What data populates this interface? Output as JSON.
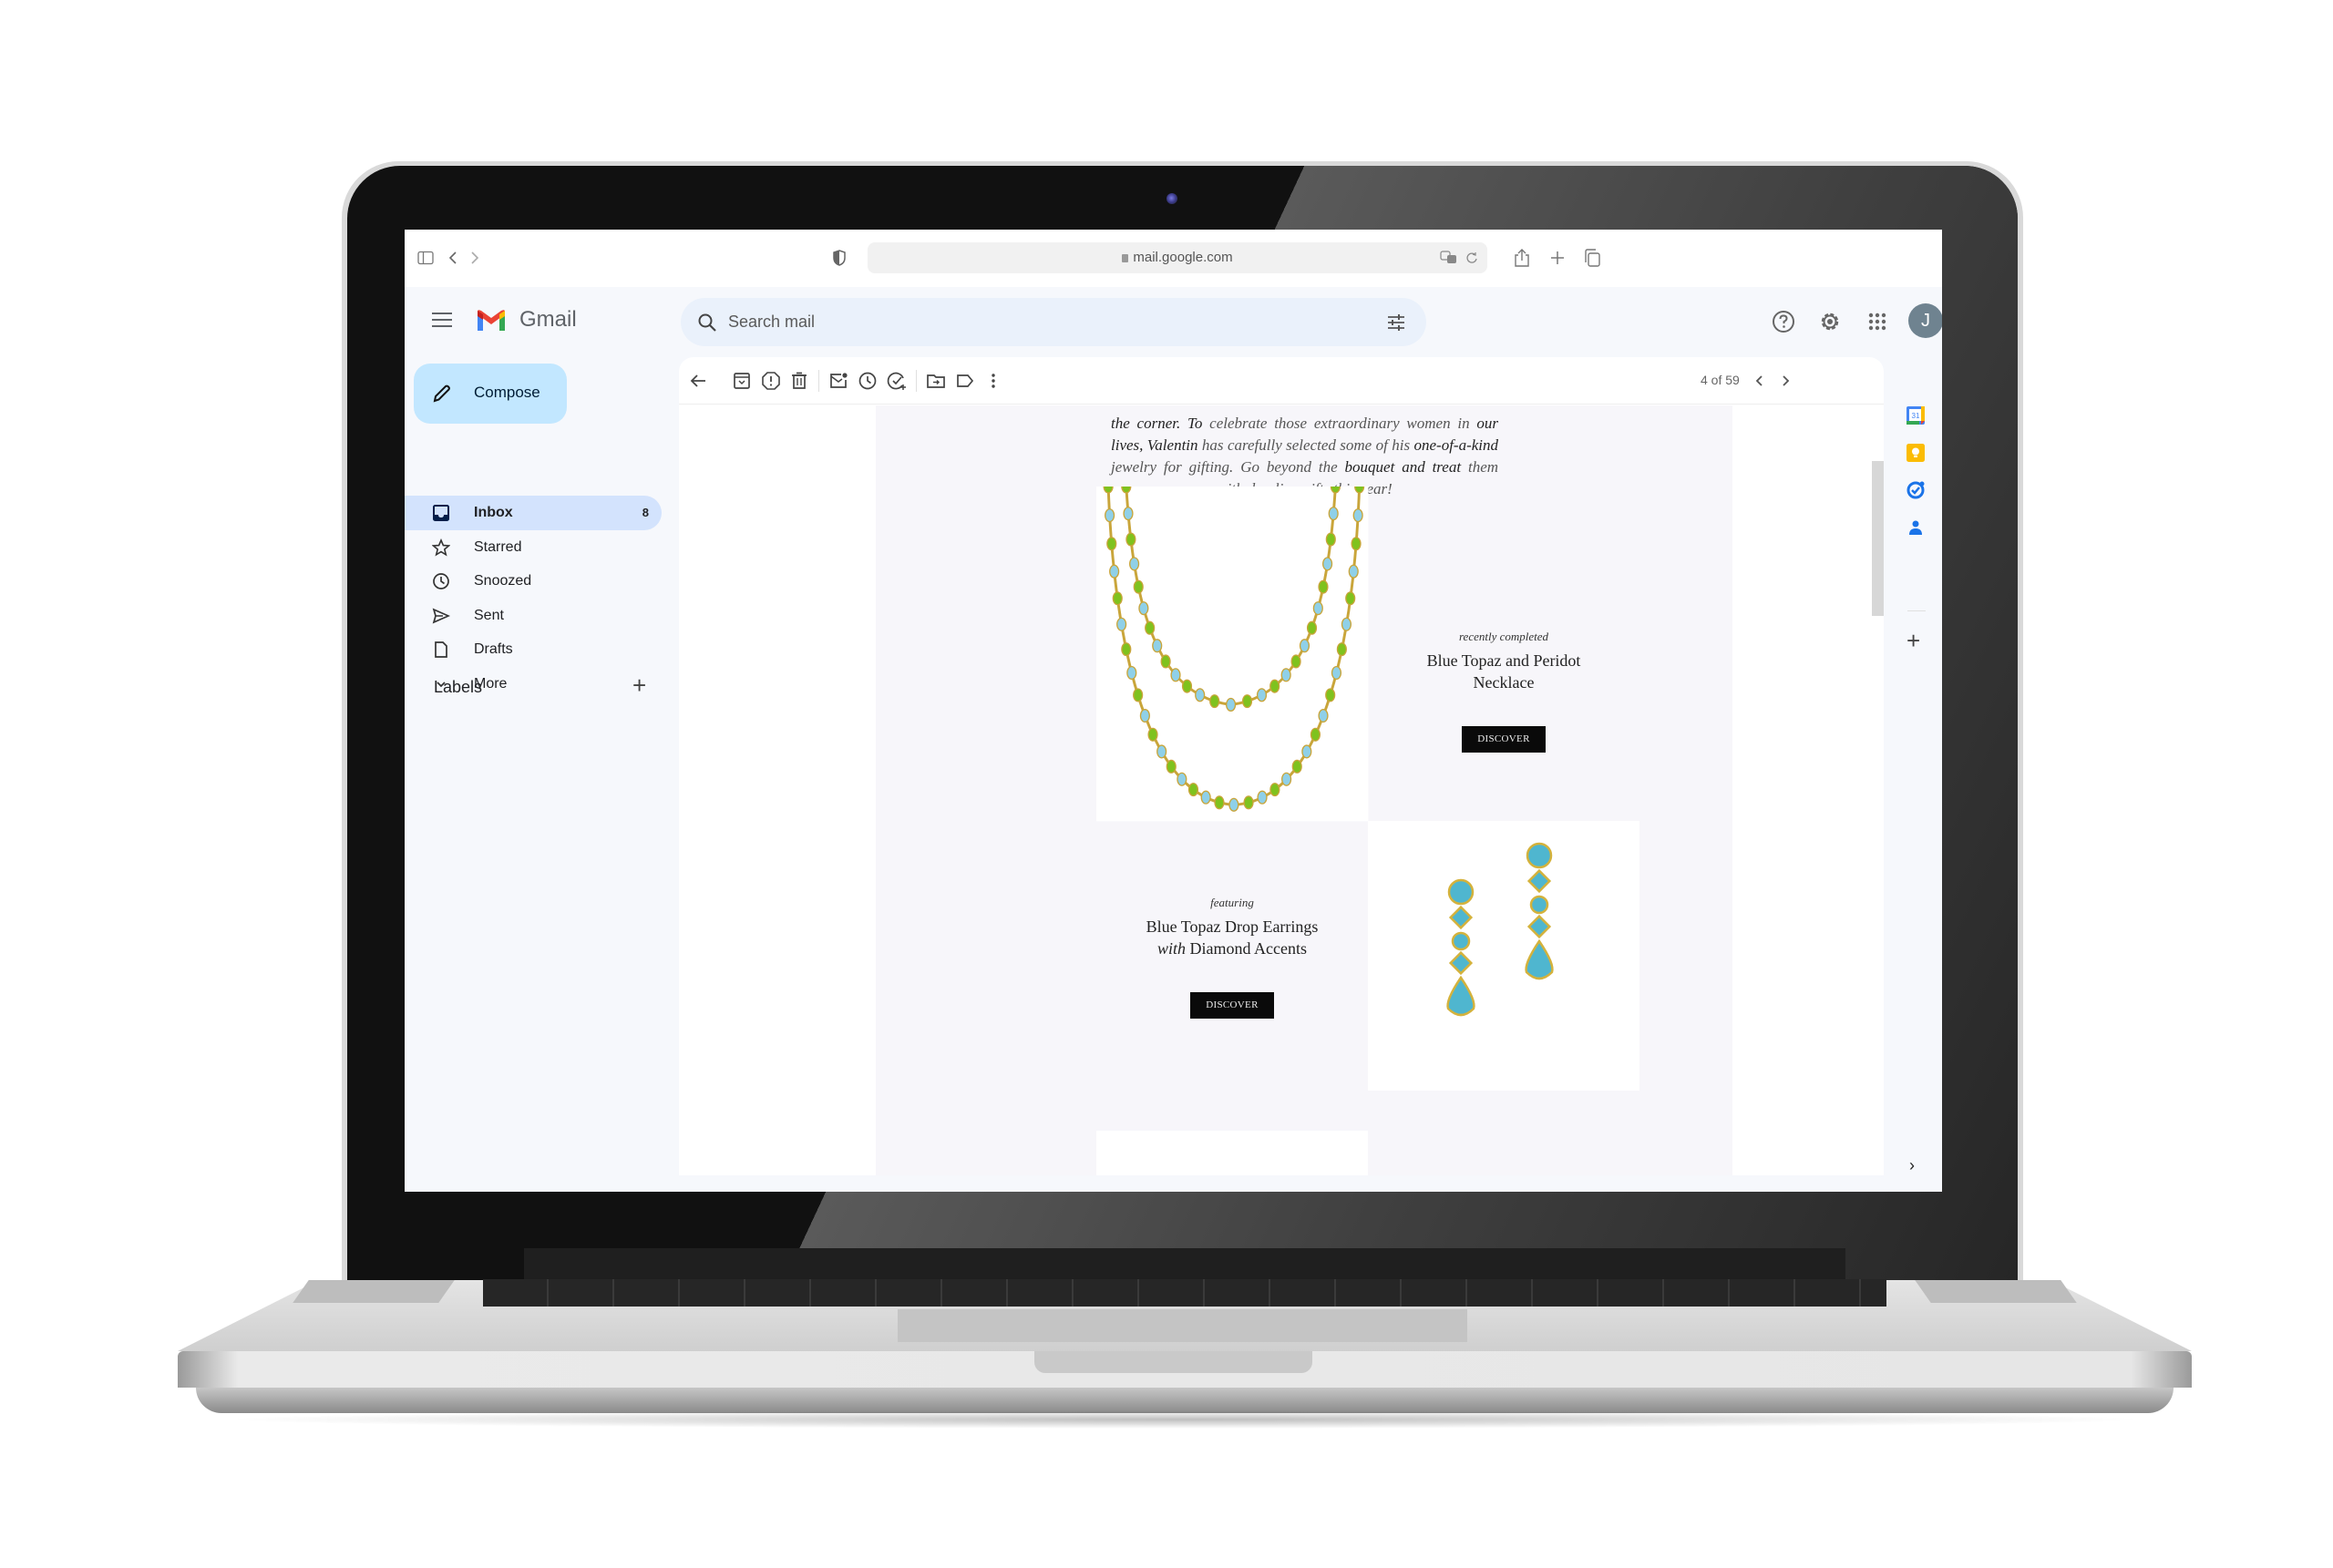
{
  "browser": {
    "url": "mail.google.com",
    "icons": [
      "sidebar-toggle-icon",
      "back-icon",
      "forward-icon",
      "privacy-shield-icon",
      "translate-icon",
      "reload-icon",
      "share-icon",
      "new-tab-icon",
      "tab-overview-icon"
    ]
  },
  "gmail": {
    "app_name": "Gmail",
    "search_placeholder": "Search mail",
    "avatar_initial": "J",
    "header_icons": [
      "help-icon",
      "settings-icon",
      "apps-grid-icon"
    ]
  },
  "sidebar": {
    "compose_label": "Compose",
    "items": [
      {
        "label": "Inbox",
        "icon": "inbox-icon",
        "count": "8",
        "active": true
      },
      {
        "label": "Starred",
        "icon": "star-icon",
        "count": "",
        "active": false
      },
      {
        "label": "Snoozed",
        "icon": "clock-icon",
        "count": "",
        "active": false
      },
      {
        "label": "Sent",
        "icon": "send-icon",
        "count": "",
        "active": false
      },
      {
        "label": "Drafts",
        "icon": "draft-icon",
        "count": "",
        "active": false
      },
      {
        "label": "More",
        "icon": "chevron-down-icon",
        "count": "",
        "active": false
      }
    ],
    "labels_heading": "Labels",
    "labels_add": "+"
  },
  "toolbar": {
    "icons": [
      "back-arrow-icon",
      "archive-icon",
      "report-spam-icon",
      "delete-icon",
      "mark-unread-icon",
      "snooze-icon",
      "add-to-tasks-icon",
      "move-to-icon",
      "label-icon",
      "more-vert-icon"
    ],
    "pager": "4 of 59"
  },
  "email": {
    "intro_segments": [
      {
        "text": "the corner.",
        "em": true
      },
      {
        "text": " To",
        "em": true
      },
      {
        "text": " celebrate those extraordinary women in ",
        "em": false
      },
      {
        "text": "our lives, Valentin",
        "em": true
      },
      {
        "text": " has carefully selected some of his ",
        "em": false
      },
      {
        "text": "one-of-a-kind",
        "em": true
      },
      {
        "text": " jewelry for gifting. Go beyond the ",
        "em": false
      },
      {
        "text": "bouquet and treat",
        "em": true
      },
      {
        "text": " them with dazzling gifts this year!",
        "em": false
      }
    ],
    "products": [
      {
        "kicker": "recently completed",
        "title_line1": "Blue Topaz and Peridot",
        "title_line2_em": "",
        "title_line2": "Necklace",
        "button": "DISCOVER",
        "image": "necklace"
      },
      {
        "kicker": "featuring",
        "title_line1": "Blue Topaz Drop Earrings",
        "title_line2_em": "with",
        "title_line2": " Diamond Accents",
        "button": "DISCOVER",
        "image": "earrings"
      }
    ]
  },
  "side_panel": {
    "apps": [
      "calendar-icon",
      "keep-icon",
      "tasks-icon",
      "contacts-icon"
    ],
    "calendar_day": "31",
    "add": "+",
    "expand": "›"
  }
}
